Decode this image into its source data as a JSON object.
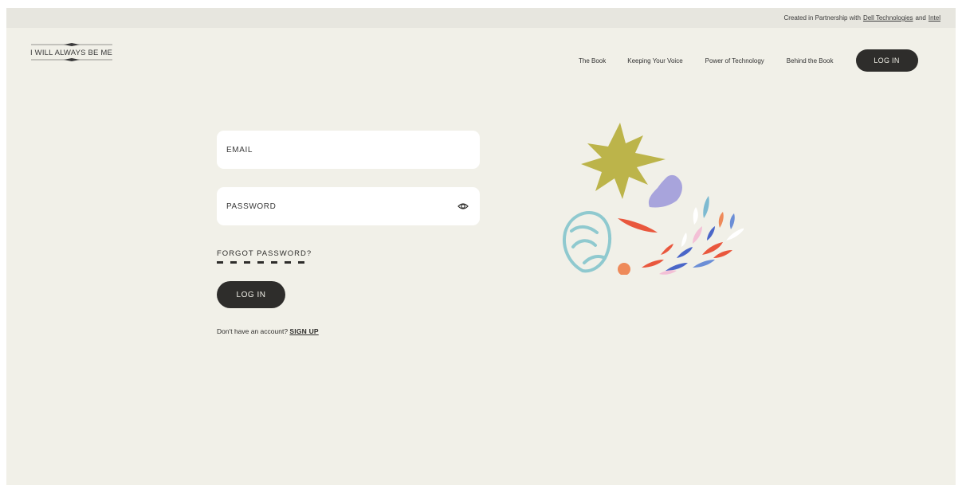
{
  "topbar": {
    "prefix": "Created in Partnership with",
    "partner1": "Dell Technologies",
    "and": "and",
    "partner2": "Intel"
  },
  "logo": {
    "text": "I WILL ALWAYS BE ME"
  },
  "nav": {
    "items": [
      "The Book",
      "Keeping Your Voice",
      "Power of Technology",
      "Behind the Book"
    ],
    "login_label": "LOG IN"
  },
  "form": {
    "email_placeholder": "EMAIL",
    "password_placeholder": "PASSWORD",
    "forgot_label": "FORGOT PASSWORD?",
    "login_button": "LOG IN",
    "no_account_text": "Don't have an account?",
    "signup_label": "SIGN UP"
  },
  "colors": {
    "background": "#f1f0e8",
    "topbar": "#e7e6df",
    "dark": "#2e2d2b",
    "field": "#ffffff"
  },
  "icons": {
    "password_toggle": "eye-icon"
  }
}
